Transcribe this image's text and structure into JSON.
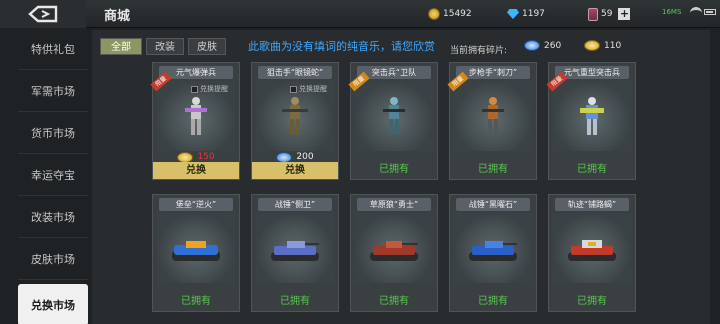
{
  "header": {
    "title": "商城",
    "coins": "15492",
    "gems": "1197",
    "cards": "59",
    "plus": "+",
    "ping": "16MS"
  },
  "sidebar": {
    "items": [
      {
        "label": "特供礼包"
      },
      {
        "label": "军需市场"
      },
      {
        "label": "货币市场"
      },
      {
        "label": "幸运夺宝"
      },
      {
        "label": "改装市场"
      },
      {
        "label": "皮肤市场"
      },
      {
        "label": "兑换市场",
        "active": true
      }
    ]
  },
  "tabs": [
    "全部",
    "改装",
    "皮肤"
  ],
  "notice": "此歌曲为没有填词的纯音乐，请您欣赏",
  "fragments": {
    "label": "当前拥有碎片:",
    "blue": "260",
    "gold": "110"
  },
  "soldiers": [
    {
      "name": "元气爆弹兵",
      "ribbon": "限量",
      "checkbox_label": "兑换提醒",
      "price": "150",
      "price_currency": "gold",
      "action": "兑换"
    },
    {
      "name": "狙击手“眼镜蛇”",
      "ribbon": "",
      "checkbox_label": "兑换提醒",
      "price": "200",
      "price_currency": "blue",
      "action": "兑换"
    },
    {
      "name": "突击兵“卫队",
      "ribbon": "限量",
      "status": "已拥有"
    },
    {
      "name": "步枪手“刺刀”",
      "ribbon": "限量",
      "status": "已拥有"
    },
    {
      "name": "元气重型突击兵",
      "ribbon": "限量",
      "status": "已拥有"
    }
  ],
  "tanks": [
    {
      "name": "堡垒“逆火”",
      "status": "已拥有"
    },
    {
      "name": "战锤“侧卫”",
      "status": "已拥有"
    },
    {
      "name": "草原狼“勇士”",
      "status": "已拥有"
    },
    {
      "name": "战锤“黑曜石”",
      "status": "已拥有"
    },
    {
      "name": "轨迹“铺路蝎”",
      "status": "已拥有"
    }
  ],
  "colors": {
    "accent_gold": "#d8c06a",
    "owned_green": "#58c84e",
    "notice_blue": "#3ea8ff",
    "price_red": "#e33333"
  }
}
